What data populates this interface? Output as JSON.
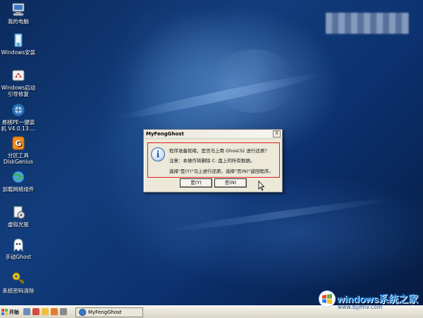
{
  "desktop": {
    "icons": [
      {
        "label": "我的电脑"
      },
      {
        "label": "Windows安装"
      },
      {
        "label": "Windows启动\n引导修复"
      },
      {
        "label": "易桃PE一键装\n机 V4.0.13...."
      },
      {
        "label": "分区工具\nDiskGenius"
      },
      {
        "label": "加载网络组件"
      },
      {
        "label": "虚拟光驱"
      },
      {
        "label": "手动Ghost"
      },
      {
        "label": "系统密码清除"
      }
    ]
  },
  "dialog": {
    "title": "MyFengGhost",
    "close_label": "X",
    "icon_glyph": "i",
    "line1": "程序准备就绪，是否马上用 Ghost32 进行还原？",
    "line2": "注意：本操作将删除 C: 盘上的所有数据。",
    "line3": "选择\"是(Y)\"马上进行还原，选择\"否(N)\"返回程序。",
    "yes_label": "是(Y)",
    "no_label": "否(N)"
  },
  "taskbar": {
    "start_label": "开始",
    "task_label": "MyFengGhost"
  },
  "watermark": {
    "title": "windows系统之家",
    "url": "www.bjjmlv.com"
  },
  "colors": {
    "highlight_border": "#e0202a",
    "watermark_blue": "#1d7fd6"
  }
}
